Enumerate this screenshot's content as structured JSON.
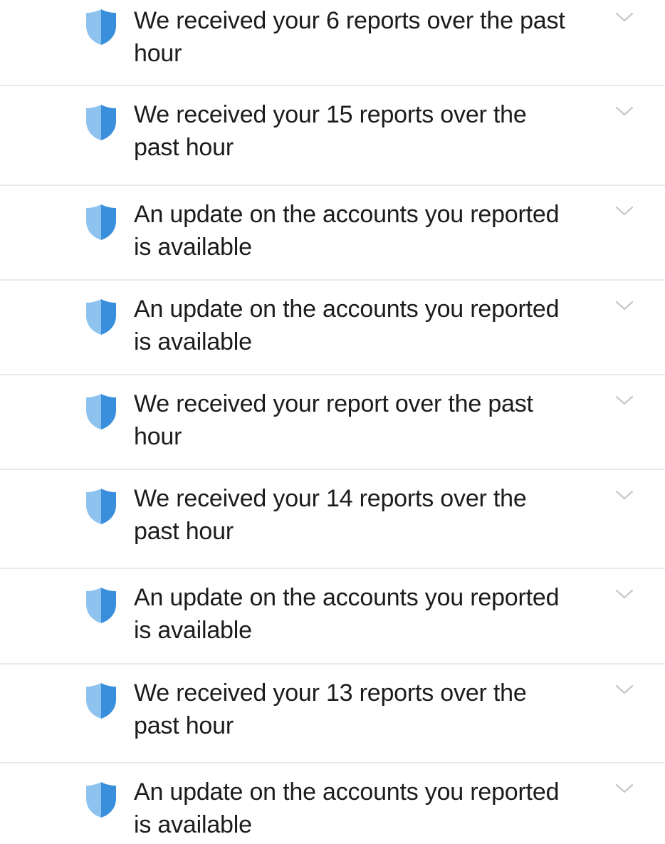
{
  "colors": {
    "shield_light": "#8ec3f0",
    "shield_dark": "#3a8fdd",
    "chevron": "#c8c8cc",
    "divider": "#e9e9ec"
  },
  "icons": {
    "row_icon": "shield-icon",
    "expand_icon": "chevron-down-icon"
  },
  "notifications": [
    {
      "line1": "We received your 6 reports over the past",
      "line2": "hour"
    },
    {
      "line1": "We received your 15 reports over the",
      "line2": "past hour"
    },
    {
      "line1": "An update on the accounts you reported",
      "line2": "is available"
    },
    {
      "line1": "An update on the accounts you reported",
      "line2": "is available"
    },
    {
      "line1": "We received your report over the past",
      "line2": "hour"
    },
    {
      "line1": "We received your 14 reports over the",
      "line2": "past hour"
    },
    {
      "line1": "An update on the accounts you reported",
      "line2": "is available"
    },
    {
      "line1": "We received your 13 reports over the",
      "line2": "past hour"
    },
    {
      "line1": "An update on the accounts you reported",
      "line2": "is available"
    }
  ]
}
